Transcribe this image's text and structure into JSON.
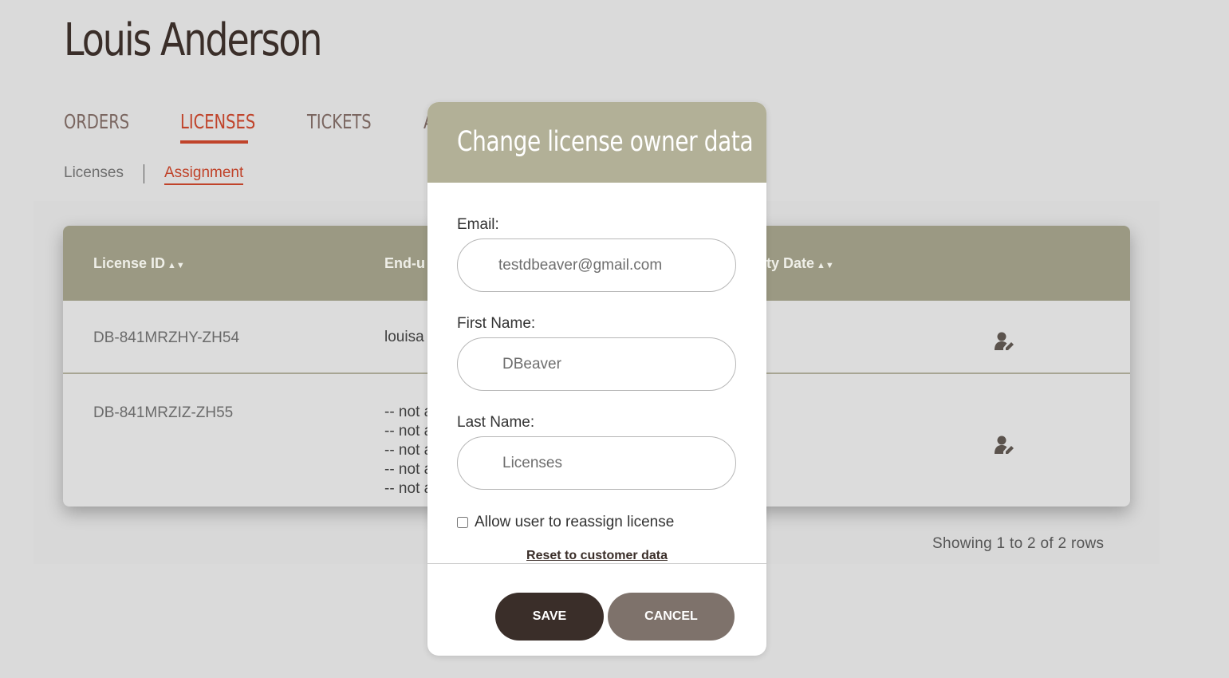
{
  "page": {
    "user_name": "Louis Anderson"
  },
  "tabs": [
    {
      "label": "ORDERS",
      "active": false
    },
    {
      "label": "LICENSES",
      "active": true
    },
    {
      "label": "TICKETS",
      "active": false
    },
    {
      "label": "A",
      "active": false
    }
  ],
  "subnav": {
    "licenses": "Licenses",
    "assignment": "Assignment"
  },
  "table": {
    "headers": {
      "license_id": "License ID",
      "end_user": "End-u",
      "expiry_date": "ty Date"
    },
    "rows": [
      {
        "license_id": "DB-841MRZHY-ZH54",
        "end_user": [
          "louisa"
        ]
      },
      {
        "license_id": "DB-841MRZIZ-ZH55",
        "end_user": [
          "-- not a",
          "-- not a",
          "-- not a",
          "-- not a",
          "-- not a"
        ]
      }
    ],
    "footer": "Showing 1 to 2 of 2 rows"
  },
  "modal": {
    "title": "Change license owner data",
    "email_label": "Email:",
    "email_value": "testdbeaver@gmail.com",
    "first_name_label": "First Name:",
    "first_name_value": "DBeaver",
    "last_name_label": "Last Name:",
    "last_name_value": "Licenses",
    "reassign_label": "Allow user to reassign license",
    "reassign_checked": false,
    "reset_label": "Reset to customer data",
    "save_label": "SAVE",
    "cancel_label": "CANCEL"
  },
  "colors": {
    "accent": "#c0432a",
    "header_bg": "#9b9983",
    "modal_header_bg": "#b2b097",
    "save_bg": "#3a2e29",
    "cancel_bg": "#7e726b"
  },
  "icons": {
    "edit_row": "user-edit-icon",
    "sort": "sort-icon"
  }
}
